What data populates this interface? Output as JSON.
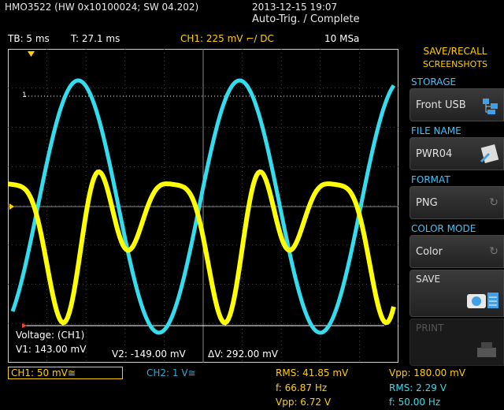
{
  "header": {
    "device": "HMO3522 (HW 0x10100024; SW 04.202)",
    "datetime": "2013-12-15 19:07",
    "trigger_status": "Auto-Trig. / Complete"
  },
  "info": {
    "tb": "TB: 5 ms",
    "t": "T: 27.1 ms",
    "ch1": "CH1: 225 mV ⌐/ DC",
    "sample": "10 MSa"
  },
  "marker": "1",
  "cursor": {
    "title": "Voltage: (CH1)",
    "v1": "V1: 143.00 mV",
    "v2": "V2: -149.00 mV",
    "dv": "ΔV: 292.00 mV"
  },
  "channels": {
    "ch1": "CH1: 50 mV≅",
    "ch2": "CH2: 1 V≅"
  },
  "measurements": {
    "ch1_rms": "RMS: 41.85 mV",
    "ch1_f": "f: 66.87 Hz",
    "ch1_vpp": "Vpp: 6.72 V",
    "ch2_vpp": "Vpp: 180.00 mV",
    "ch2_rms": "RMS: 2.29 V",
    "ch2_f": "f: 50.00 Hz"
  },
  "softmenu": {
    "title_line1": "SAVE/RECALL",
    "title_line2": "SCREENSHOTS",
    "storage_label": "STORAGE",
    "storage_value": "Front USB",
    "filename_label": "FILE NAME",
    "filename_value": "PWR04",
    "format_label": "FORMAT",
    "format_value": "PNG",
    "colormode_label": "COLOR MODE",
    "colormode_value": "Color",
    "save_label": "SAVE",
    "print_label": "PRINT"
  },
  "colors": {
    "ch1": "#ffff00",
    "ch2": "#33ddee",
    "accent_label": "#3fc3ff",
    "title": "#ffd000"
  }
}
